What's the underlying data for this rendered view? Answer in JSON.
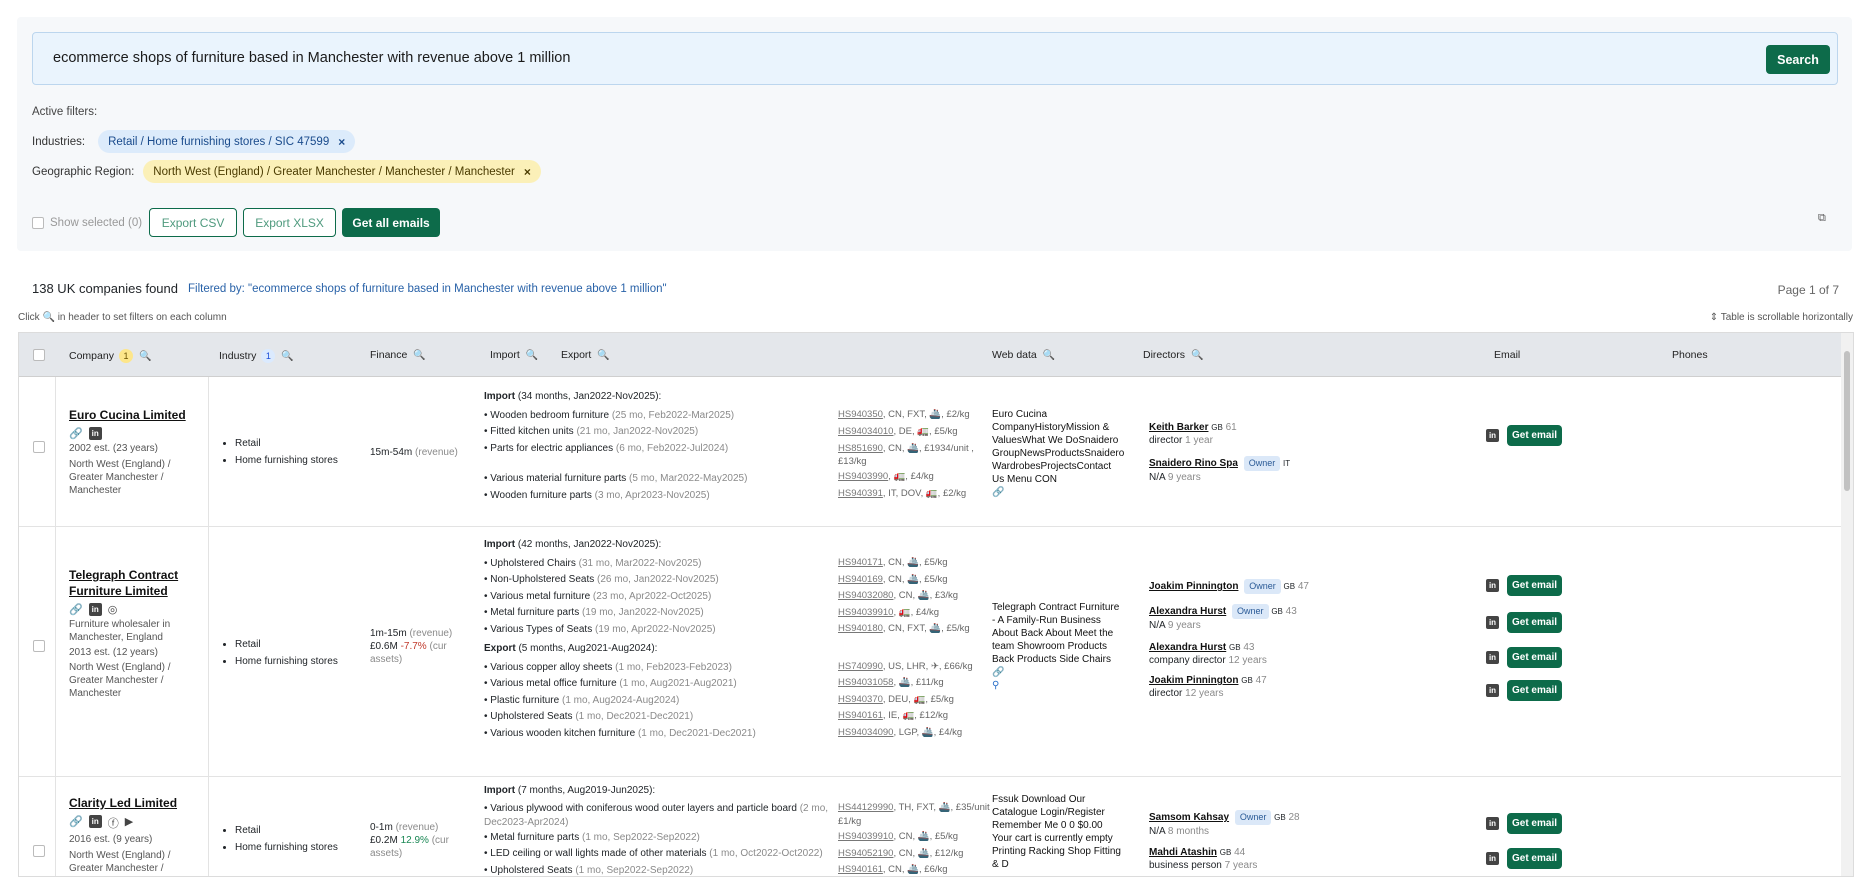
{
  "search": {
    "query": "ecommerce shops of furniture based in Manchester with revenue above 1 million",
    "button": "Search"
  },
  "filters": {
    "title": "Active filters:",
    "industries_label": "Industries:",
    "industries_chip": "Retail / Home furnishing stores / SIC 47599",
    "region_label": "Geographic Region:",
    "region_chip": "North West (England) / Greater Manchester / Manchester / Manchester",
    "remove": "×"
  },
  "actions": {
    "show_selected": "Show selected (0)",
    "export_csv": "Export CSV",
    "export_xlsx": "Export XLSX",
    "get_all_emails": "Get all emails"
  },
  "summary": {
    "count": "138 UK companies found",
    "filtered": "Filtered by: \"ecommerce shops of furniture based in Manchester with revenue above 1 million\"",
    "page": "Page 1 of 7",
    "hint_pre": "Click",
    "hint_post": "in header to set filters on each column",
    "scroll_hint": "Table is scrollable horizontally"
  },
  "headers": {
    "company": "Company",
    "company_badge": "1",
    "industry": "Industry",
    "industry_badge": "1",
    "finance": "Finance",
    "import": "Import",
    "export": "Export",
    "web": "Web data",
    "directors": "Directors",
    "email": "Email",
    "phones": "Phones"
  },
  "rows": [
    {
      "name": "Euro Cucina Limited",
      "est": "2002 est. (23 years)",
      "region": "North West (England) / Greater Manchester / Manchester",
      "industries": [
        "Retail",
        "Home furnishing stores"
      ],
      "finance_range": "15m-54m",
      "finance_note": "(revenue)",
      "import_title": "Import",
      "import_period": "(34 months, Jan2022-Nov2025):",
      "items": [
        {
          "name": "• Wooden bedroom furniture",
          "meta": "(25 mo, Feb2022-Mar2025)",
          "code": "HS940350",
          "rest": ", CN, FXT, 🚢, £2/kg"
        },
        {
          "name": "• Fitted kitchen units",
          "meta": "(21 mo, Jan2022-Nov2025)",
          "code": "HS94034010",
          "rest": ", DE, 🚛, £5/kg"
        },
        {
          "name": "• Parts for electric appliances",
          "meta": "(6 mo, Feb2022-Jul2024)",
          "code": "HS851690",
          "rest": ", CN, 🚢, £1934/unit ,"
        },
        {
          "name": "",
          "meta": "",
          "code": "",
          "rest": "£13/kg"
        },
        {
          "name": "• Various material furniture parts",
          "meta": "(5 mo, Mar2022-May2025)",
          "code": "HS9403990",
          "rest": ", 🚛, £4/kg"
        },
        {
          "name": "• Wooden furniture parts",
          "meta": "(3 mo, Apr2023-Nov2025)",
          "code": "HS940391",
          "rest": ", IT, DOV, 🚛, £2/kg"
        }
      ],
      "web": "Euro Cucina CompanyHistoryMission & ValuesWhat We DoSnaidero GroupNewsProductsSnaidero WardrobesProjectsContact Us Menu CON",
      "directors": [
        {
          "name": "Keith Barker",
          "flag": "GB",
          "age": "61",
          "role": "director",
          "tenure": "1 year",
          "owner": ""
        },
        {
          "name": "Snaidero Rino Spa",
          "flag": "IT",
          "age": "",
          "role": "N/A",
          "tenure": "9 years",
          "owner": "Owner"
        }
      ],
      "email_btn": "Get email"
    },
    {
      "name": "Telegraph Contract Furniture Limited",
      "desc": "Furniture wholesaler in Manchester, England",
      "est": "2013 est. (12 years)",
      "region": "North West (England) / Greater Manchester / Manchester",
      "industries": [
        "Retail",
        "Home furnishing stores"
      ],
      "finance_range": "1m-15m",
      "finance_note": "(revenue)",
      "finance2": "£0.6M",
      "finance2_change": "-7.7%",
      "finance2_note": "(cur assets)",
      "import_title": "Import",
      "import_period": "(42 months, Jan2022-Nov2025):",
      "items": [
        {
          "name": "• Upholstered Chairs",
          "meta": "(31 mo, Mar2022-Nov2025)",
          "code": "HS940171",
          "rest": ", CN, 🚢, £5/kg"
        },
        {
          "name": "• Non-Upholstered Seats",
          "meta": "(26 mo, Jan2022-Nov2025)",
          "code": "HS940169",
          "rest": ", CN, 🚢, £5/kg"
        },
        {
          "name": "• Various metal furniture",
          "meta": "(23 mo, Apr2022-Oct2025)",
          "code": "HS94032080",
          "rest": ", CN, 🚢, £3/kg"
        },
        {
          "name": "• Metal furniture parts",
          "meta": "(19 mo, Jan2022-Nov2025)",
          "code": "HS94039910",
          "rest": ", 🚛, £4/kg"
        },
        {
          "name": "• Various Types of Seats",
          "meta": "(19 mo, Apr2022-Nov2025)",
          "code": "HS940180",
          "rest": ", CN, FXT, 🚢, £5/kg"
        }
      ],
      "export_title": "Export",
      "export_period": "(5 months, Aug2021-Aug2024):",
      "export_items": [
        {
          "name": "• Various copper alloy sheets",
          "meta": "(1 mo, Feb2023-Feb2023)",
          "code": "HS740990",
          "rest": ", US, LHR, ✈, £66/kg"
        },
        {
          "name": "• Various metal office furniture",
          "meta": "(1 mo, Aug2021-Aug2021)",
          "code": "HS94031058",
          "rest": ", 🚢, £11/kg"
        },
        {
          "name": "• Plastic furniture",
          "meta": "(1 mo, Aug2024-Aug2024)",
          "code": "HS940370",
          "rest": ", DEU, 🚛, £5/kg"
        },
        {
          "name": "• Upholstered Seats",
          "meta": "(1 mo, Dec2021-Dec2021)",
          "code": "HS940161",
          "rest": ", IE, 🚛, £12/kg"
        },
        {
          "name": "• Various wooden kitchen furniture",
          "meta": "(1 mo, Dec2021-Dec2021)",
          "code": "HS94034090",
          "rest": ", LGP, 🚢, £4/kg"
        }
      ],
      "web": "Telegraph Contract Furniture - A Family-Run Business About Back About Meet the team Showroom Products Back Products Side Chairs",
      "directors": [
        {
          "name": "Joakim Pinnington",
          "flag": "GB",
          "age": "47",
          "role": "",
          "tenure": "",
          "owner": "Owner"
        },
        {
          "name": "Alexandra Hurst",
          "flag": "GB",
          "age": "43",
          "role": "N/A",
          "tenure": "9 years",
          "owner": "Owner"
        },
        {
          "name": "Alexandra Hurst",
          "flag": "GB",
          "age": "43",
          "role": "company director",
          "tenure": "12 years",
          "owner": ""
        },
        {
          "name": "Joakim Pinnington",
          "flag": "GB",
          "age": "47",
          "role": "director",
          "tenure": "12 years",
          "owner": ""
        }
      ],
      "email_btn": "Get email"
    },
    {
      "name": "Clarity Led Limited",
      "est": "2016 est. (9 years)",
      "region": "North West (England) / Greater Manchester /",
      "industries": [
        "Retail",
        "Home furnishing stores"
      ],
      "finance_range": "0-1m",
      "finance_note": "(revenue)",
      "finance2": "£0.2M",
      "finance2_change": "12.9%",
      "finance2_note": "(cur assets)",
      "import_title": "Import",
      "import_period": "(7 months, Aug2019-Jun2025):",
      "items": [
        {
          "name": "• Various plywood with coniferous wood outer layers and particle board",
          "meta": "(2 mo, Dec2023-Apr2024)",
          "code": "HS44129990",
          "rest": ", TH, FXT, 🚢, £35/unit , £1/kg"
        },
        {
          "name": "• Metal furniture parts",
          "meta": "(1 mo, Sep2022-Sep2022)",
          "code": "HS94039910",
          "rest": ", CN, 🚢, £5/kg"
        },
        {
          "name": "• LED ceiling or wall lights made of other materials",
          "meta": "(1 mo, Oct2022-Oct2022)",
          "code": "HS94052190",
          "rest": ", CN, 🚢, £12/kg"
        },
        {
          "name": "• Upholstered Seats",
          "meta": "(1 mo, Sep2022-Sep2022)",
          "code": "HS940161",
          "rest": ", CN, 🚢, £6/kg"
        }
      ],
      "web": "Fssuk Download Our Catalogue Login/Register Remember Me 0 0 $0.00 Your cart is currently empty Printing Racking Shop Fitting & D",
      "directors": [
        {
          "name": "Samsom Kahsay",
          "flag": "GB",
          "age": "28",
          "role": "N/A",
          "tenure": "8 months",
          "owner": "Owner"
        },
        {
          "name": "Mahdi Atashin",
          "flag": "GB",
          "age": "44",
          "role": "business person",
          "tenure": "7 years",
          "owner": ""
        }
      ],
      "email_btn": "Get email"
    }
  ]
}
